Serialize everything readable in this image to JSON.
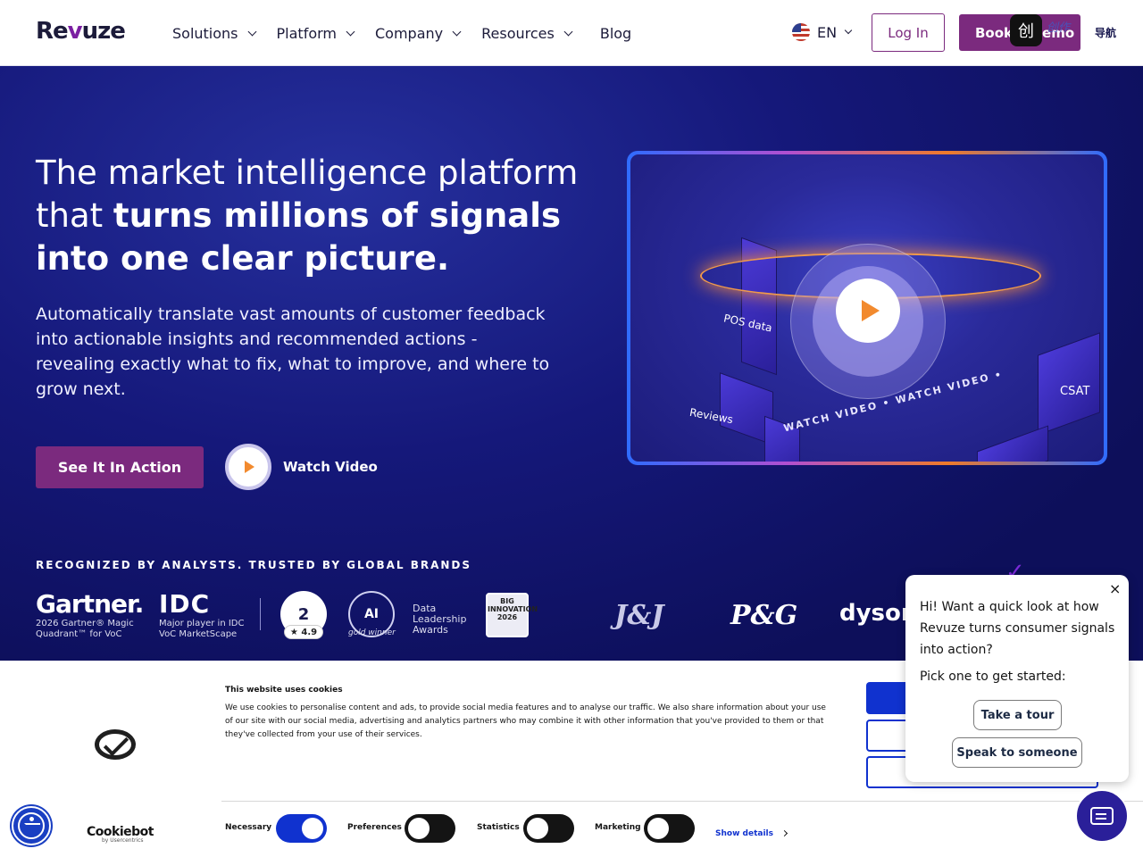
{
  "header": {
    "logo": "Revuze",
    "nav": [
      {
        "label": "Solutions"
      },
      {
        "label": "Platform"
      },
      {
        "label": "Company"
      },
      {
        "label": "Resources"
      },
      {
        "label": "Blog"
      }
    ],
    "language": "EN",
    "login_label": "Log In",
    "demo_label": "Book a Demo",
    "overlay_text": "创作",
    "overlay_text2": "导航"
  },
  "hero": {
    "headline_plain": "The market intelligence platform that ",
    "headline_bold": "turns millions of signals into one clear picture.",
    "subtext": "Automatically translate vast amounts of customer feedback into actionable insights and recommended actions - revealing exactly what to fix, what to improve, and where to grow next.",
    "cta_label": "See It In Action",
    "watch_label": "Watch Video"
  },
  "video": {
    "ring_text": "WATCH VIDEO • WATCH VIDEO •",
    "labels": {
      "pos": "POS data",
      "reviews": "Reviews",
      "csat": "CSAT"
    }
  },
  "trust": {
    "label": "RECOGNIZED BY ANALYSTS. TRUSTED BY GLOBAL BRANDS",
    "gartner": {
      "name": "Gartner.",
      "caption": "2026 Gartner® Magic Quadrant™ for VoC"
    },
    "idc": {
      "name": "IDC",
      "caption": "Major player in IDC VoC MarketScape"
    },
    "g2": {
      "name": "2",
      "score": "4.9"
    },
    "ai": {
      "name": "AI",
      "caption": "gold winner"
    },
    "dla": "Data Leadership Awards",
    "big": "BIG INNOVATION 2026",
    "brands": [
      "J&J",
      "P&G",
      "dyson"
    ]
  },
  "cookie": {
    "title": "This website uses cookies",
    "body": "We use cookies to personalise content and ads, to provide social media features and to analyse our traffic. We also share information about your use of our site with our social media, advertising and analytics partners who may combine it with other information that you've provided to them or that they've collected from your use of their services.",
    "brand": "Cookiebot",
    "brand_sub": "by Usercentrics",
    "toggles": [
      {
        "label": "Necessary",
        "on": true
      },
      {
        "label": "Preferences",
        "on": false
      },
      {
        "label": "Statistics",
        "on": false
      },
      {
        "label": "Marketing",
        "on": false
      }
    ],
    "show_details": "Show details"
  },
  "chat": {
    "message": "Hi! Want a quick look at how Revuze turns consumer signals into action?",
    "prompt": "Pick one to get started:",
    "option_tour": "Take a tour",
    "option_speak": "Speak to someone",
    "close": "×"
  },
  "colors": {
    "brand_purple": "#7b2a7e",
    "hero_bg": "#0d0f5a",
    "cookie_blue": "#1032cf"
  }
}
